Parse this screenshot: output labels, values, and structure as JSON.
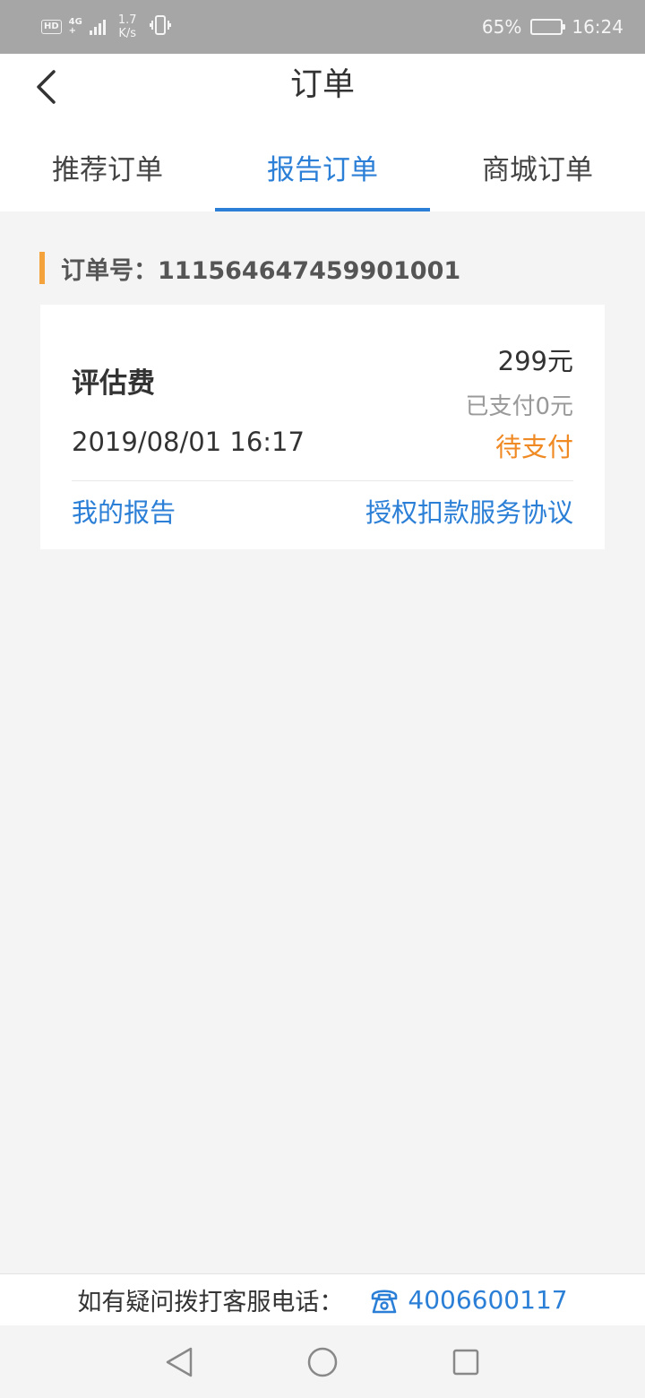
{
  "status_bar": {
    "hd": "HD",
    "network_type": "4G",
    "network_sub": "+",
    "speed_value": "1.7",
    "speed_unit": "K/s",
    "battery_percent": "65%",
    "battery_level": 0.65,
    "time": "16:24"
  },
  "header": {
    "title": "订单"
  },
  "tabs": [
    {
      "label": "推荐订单",
      "active": false
    },
    {
      "label": "报告订单",
      "active": true
    },
    {
      "label": "商城订单",
      "active": false
    }
  ],
  "order": {
    "order_no_label": "订单号：111564647459901001",
    "item_name": "评估费",
    "price": "299元",
    "paid": "已支付0元",
    "date": "2019/08/01 16:17",
    "status": "待支付",
    "link_report": "我的报告",
    "link_agreement": "授权扣款服务协议"
  },
  "footer": {
    "help_text": "如有疑问拨打客服电话：",
    "phone": "4006600117"
  },
  "colors": {
    "accent": "#2b7fd6",
    "pending": "#f08a24",
    "marker": "#f3a23c",
    "status_bar": "#a6a6a6"
  },
  "icons": {
    "back": "chevron-left-icon",
    "phone": "phone-icon",
    "nav_back": "triangle-back-icon",
    "nav_home": "circle-home-icon",
    "nav_recent": "square-recent-icon"
  }
}
